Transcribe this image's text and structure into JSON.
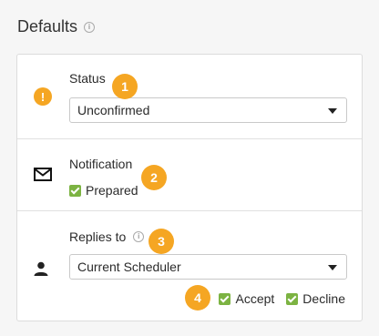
{
  "header": {
    "title": "Defaults",
    "info_icon": "info-circle-icon"
  },
  "status": {
    "label": "Status",
    "icon": "exclamation-circle-icon",
    "icon_glyph": "!",
    "select_value": "Unconfirmed",
    "badge": "1"
  },
  "notification": {
    "label": "Notification",
    "icon": "envelope-icon",
    "checkbox_label": "Prepared",
    "checkbox_checked": true,
    "badge": "2"
  },
  "replies": {
    "label": "Replies to",
    "icon": "person-icon",
    "info_icon": "info-circle-icon",
    "select_value": "Current Scheduler",
    "badge": "3",
    "checks_badge": "4",
    "accept_label": "Accept",
    "accept_checked": true,
    "decline_label": "Decline",
    "decline_checked": true
  },
  "colors": {
    "accent": "#f5a623",
    "checkbox": "#7cb342",
    "background": "#f6f6f6",
    "card": "#ffffff"
  }
}
